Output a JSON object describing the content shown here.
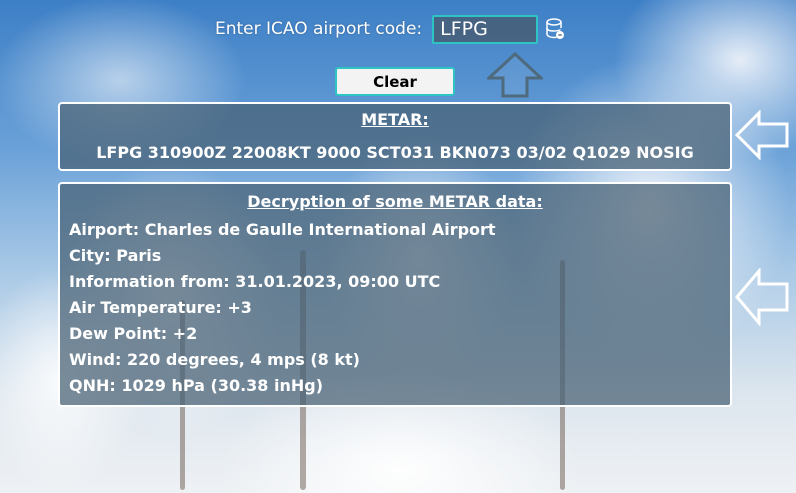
{
  "header": {
    "prompt_label": "Enter ICAO airport code:",
    "icao_value": "LFPG"
  },
  "controls": {
    "clear_label": "Clear"
  },
  "metar": {
    "title": "METAR:",
    "text": "LFPG 310900Z 22008KT 9000 SCT031 BKN073 03/02 Q1029 NOSIG"
  },
  "decryption": {
    "title": "Decryption of some METAR data:",
    "lines": [
      "Airport: Charles de Gaulle International Airport",
      "City: Paris",
      "Information from: 31.01.2023, 09:00 UTC",
      "Air Temperature: +3",
      "Dew Point: +2",
      "Wind: 220 degrees, 4 mps (8 kt)",
      "QNH: 1029 hPa (30.38 inHg)"
    ]
  },
  "icons": {
    "database": "database-icon",
    "arrow_up": "arrow-up-outline-icon",
    "arrow_left": "arrow-left-outline-icon"
  },
  "colors": {
    "accent": "#2fc4c4",
    "panel_bg": "#465f73",
    "arrow_stroke": "#4f6a7d"
  }
}
